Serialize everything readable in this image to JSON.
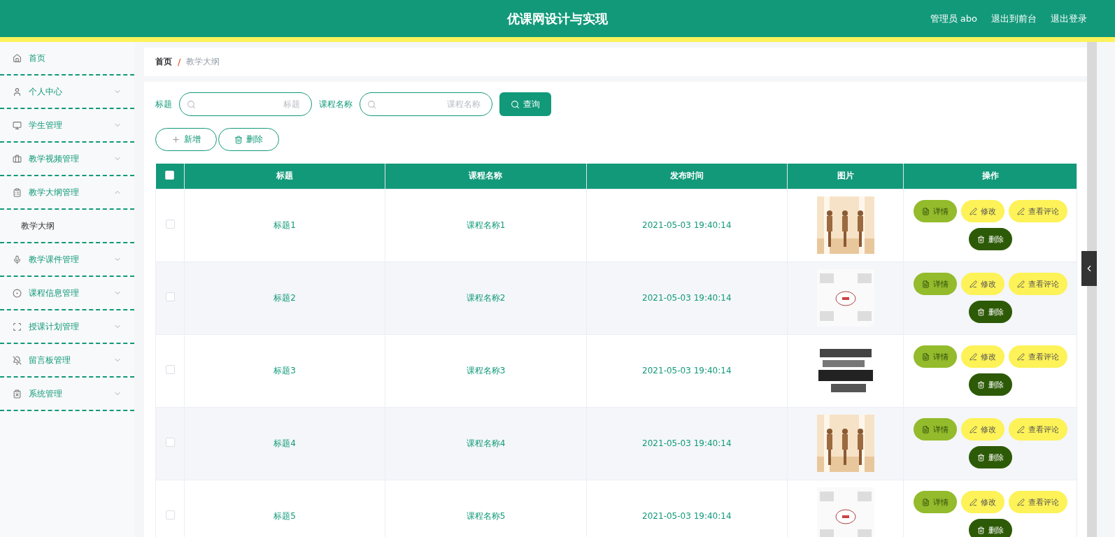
{
  "header": {
    "title": "优课网设计与实现",
    "links": [
      "管理员 abo",
      "退出到前台",
      "退出登录"
    ]
  },
  "sidebar": {
    "items": [
      {
        "label": "首页"
      },
      {
        "label": "个人中心",
        "expanded": false
      },
      {
        "label": "学生管理",
        "expanded": false
      },
      {
        "label": "教学视频管理",
        "expanded": false
      },
      {
        "label": "教学大纲管理",
        "expanded": true,
        "children": [
          {
            "label": "教学大纲"
          }
        ]
      },
      {
        "label": "教学课件管理",
        "expanded": false
      },
      {
        "label": "课程信息管理",
        "expanded": false
      },
      {
        "label": "授课计划管理",
        "expanded": false
      },
      {
        "label": "留言板管理",
        "expanded": false
      },
      {
        "label": "系统管理",
        "expanded": false
      }
    ]
  },
  "breadcrumb": {
    "home": "首页",
    "separator": "/",
    "current": "教学大纲"
  },
  "search": {
    "fields": [
      {
        "label": "标题",
        "placeholder": "标题"
      },
      {
        "label": "课程名称",
        "placeholder": "课程名称"
      }
    ],
    "button": "查询"
  },
  "toolbar": {
    "add": "新增",
    "delete": "删除"
  },
  "table": {
    "header_checked": false,
    "columns": [
      "标题",
      "课程名称",
      "发布时间",
      "图片",
      "操作"
    ],
    "rows": [
      {
        "checked": false,
        "title": "标题1",
        "course": "课程名称1",
        "time": "2021-05-03 19:40:14",
        "image": {
          "kind": "picture"
        },
        "actions": [
          {
            "kind": "detail",
            "label": "详情"
          },
          {
            "kind": "edit",
            "label": "修改"
          },
          {
            "kind": "comments",
            "label": "查看评论"
          },
          {
            "kind": "delete",
            "label": "删除"
          }
        ]
      },
      {
        "checked": false,
        "title": "标题2",
        "course": "课程名称2",
        "time": "2021-05-03 19:40:14",
        "image": {
          "kind": "picture"
        },
        "actions": [
          {
            "kind": "detail",
            "label": "详情"
          },
          {
            "kind": "edit",
            "label": "修改"
          },
          {
            "kind": "comments",
            "label": "查看评论"
          },
          {
            "kind": "delete",
            "label": "删除"
          }
        ]
      },
      {
        "checked": false,
        "title": "标题3",
        "course": "课程名称3",
        "time": "2021-05-03 19:40:14",
        "image": {
          "kind": "picture"
        },
        "actions": [
          {
            "kind": "detail",
            "label": "详情"
          },
          {
            "kind": "edit",
            "label": "修改"
          },
          {
            "kind": "comments",
            "label": "查看评论"
          },
          {
            "kind": "delete",
            "label": "删除"
          }
        ]
      },
      {
        "checked": false,
        "title": "标题4",
        "course": "课程名称4",
        "time": "2021-05-03 19:40:14",
        "image": {
          "kind": "picture"
        },
        "actions": [
          {
            "kind": "detail",
            "label": "详情"
          },
          {
            "kind": "edit",
            "label": "修改"
          },
          {
            "kind": "comments",
            "label": "查看评论"
          },
          {
            "kind": "delete",
            "label": "删除"
          }
        ]
      },
      {
        "checked": false,
        "title": "标题5",
        "course": "课程名称5",
        "time": "2021-05-03 19:40:14",
        "image": {
          "kind": "picture"
        },
        "actions": [
          {
            "kind": "detail",
            "label": "详情"
          },
          {
            "kind": "edit",
            "label": "修改"
          },
          {
            "kind": "comments",
            "label": "查看评论"
          },
          {
            "kind": "delete",
            "label": "删除"
          }
        ]
      }
    ]
  }
}
